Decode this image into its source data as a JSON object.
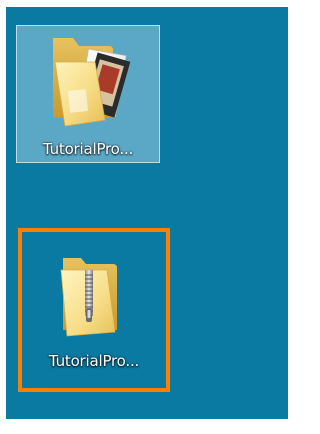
{
  "desktop": {
    "background_color": "#0a7aa3",
    "items": [
      {
        "label": "TutorialPro...",
        "icon": "folder-icon",
        "selected": true
      },
      {
        "label": "TutorialPro...",
        "icon": "zip-folder-icon",
        "highlighted": true,
        "highlight_color": "#ff7f00"
      }
    ]
  }
}
